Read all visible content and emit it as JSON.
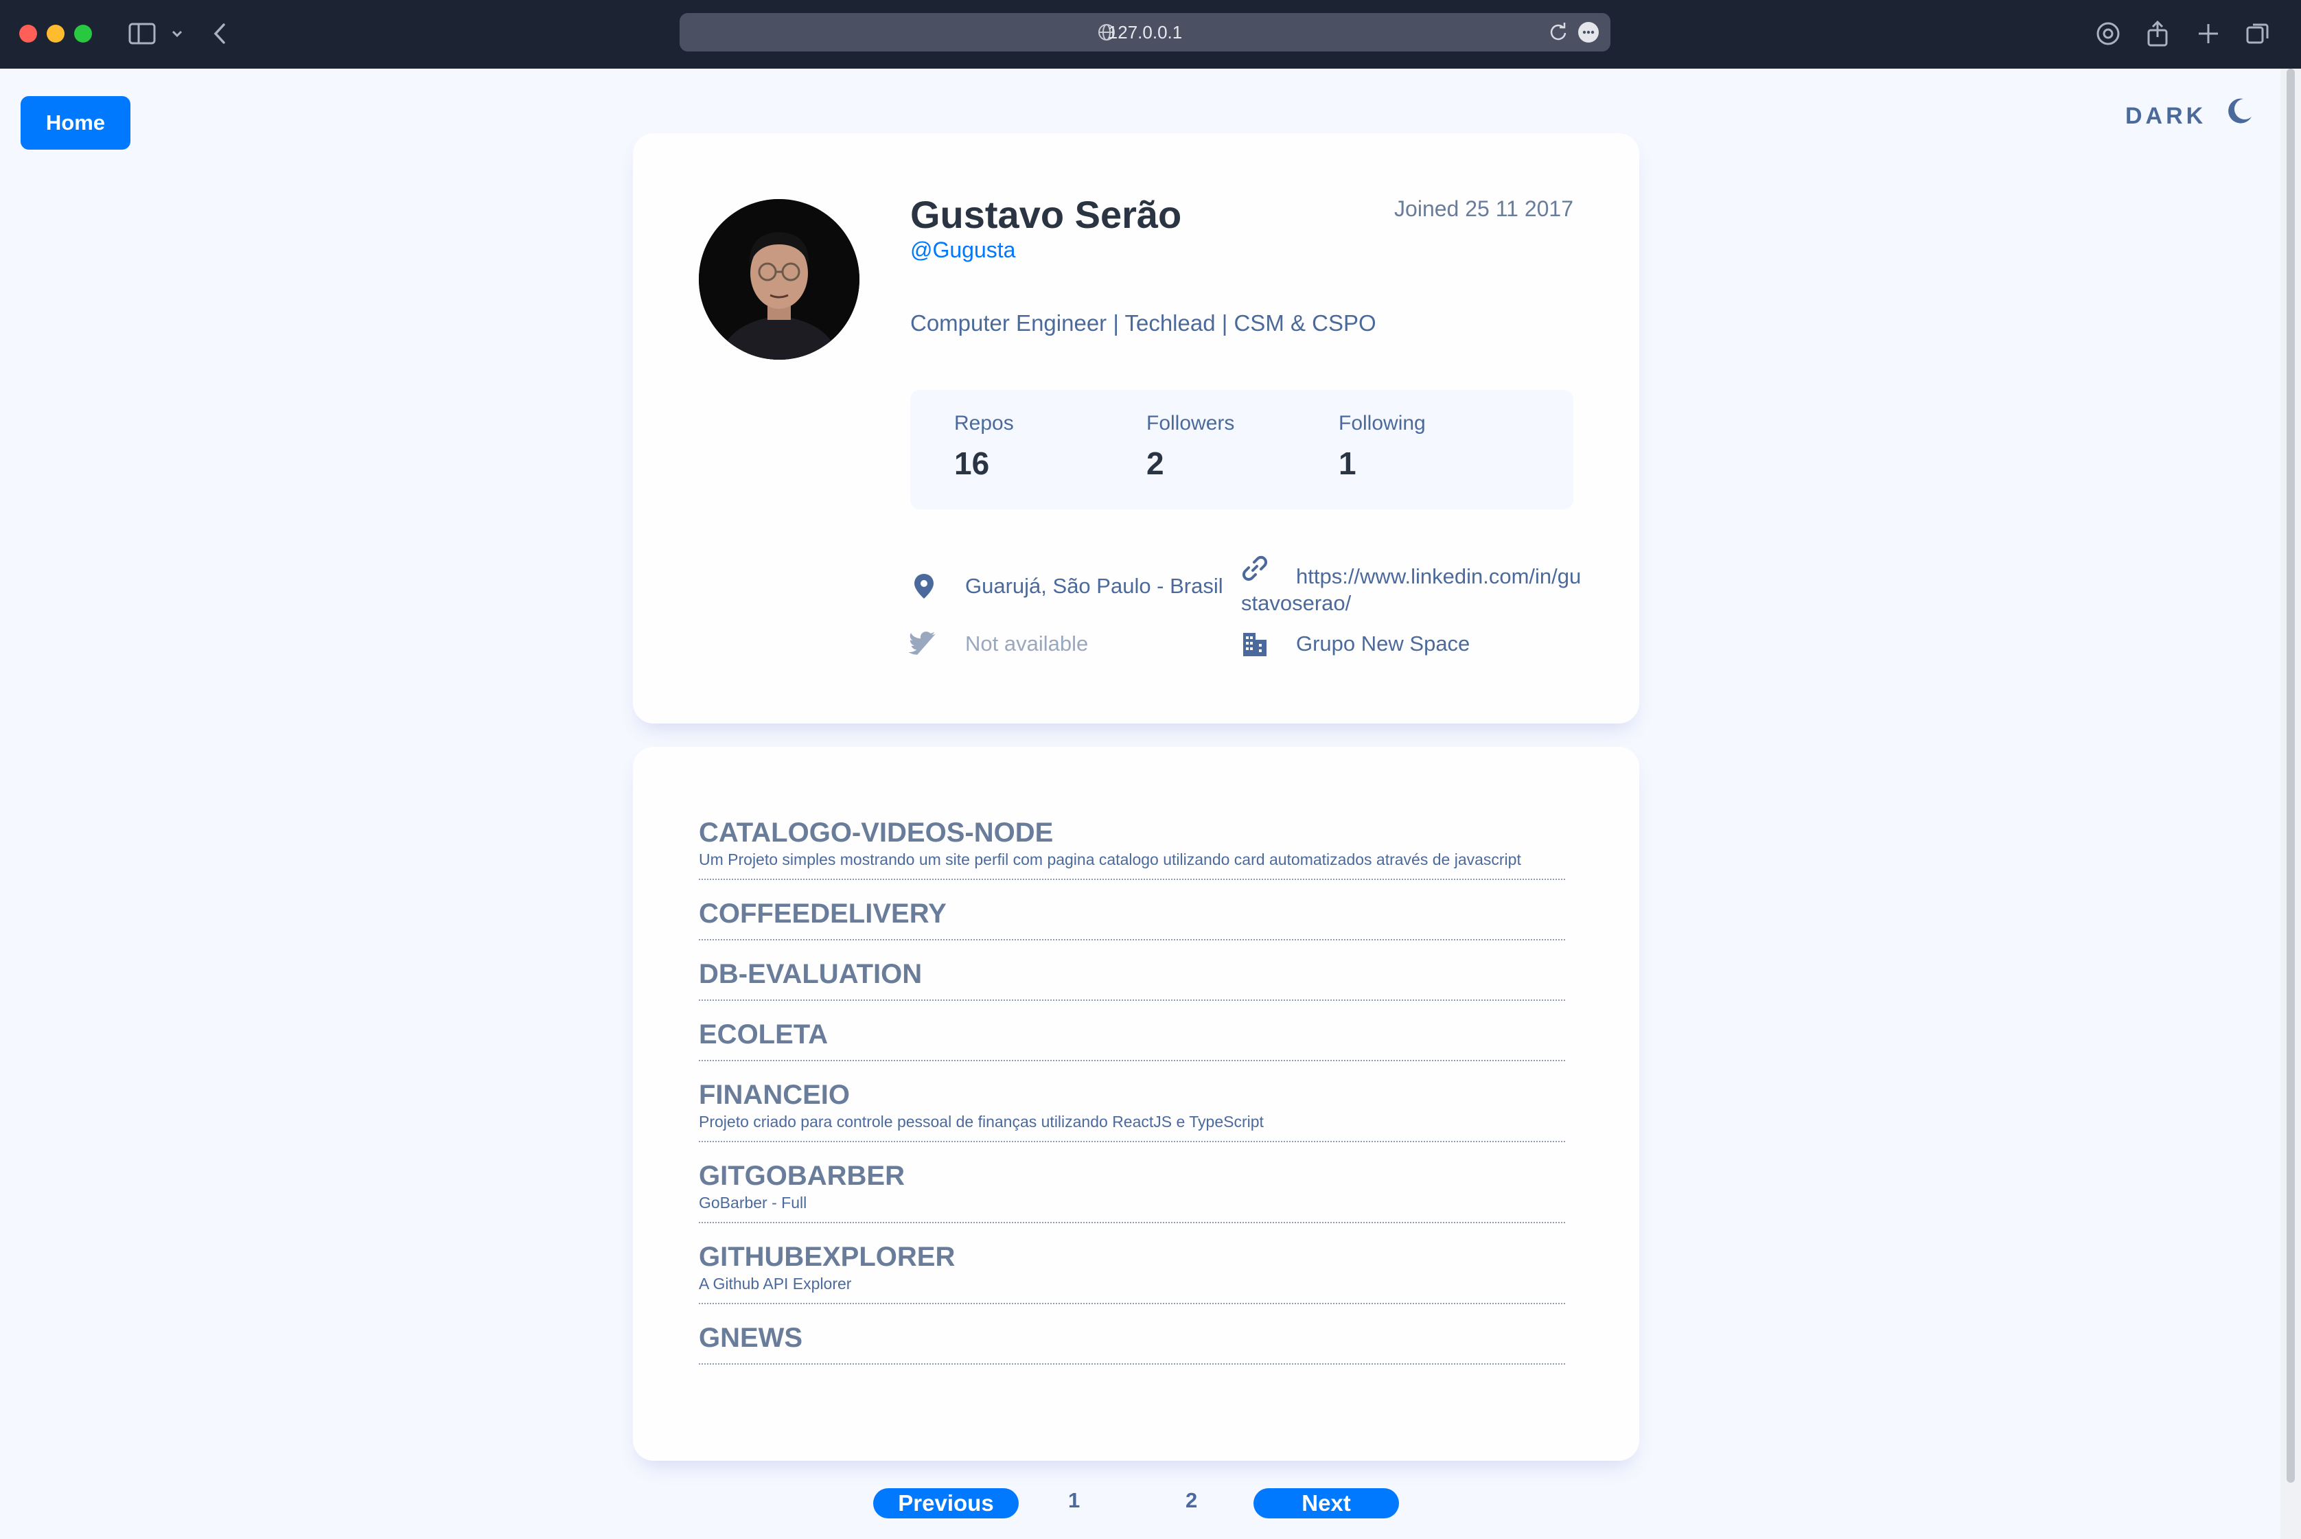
{
  "browser": {
    "url": "127.0.0.1"
  },
  "header": {
    "home_label": "Home",
    "theme_label": "DARK"
  },
  "profile": {
    "name": "Gustavo Serão",
    "handle": "@Gugusta",
    "joined": "Joined 25 11 2017",
    "bio": "Computer Engineer | Techlead | CSM & CSPO",
    "stats": {
      "repos_label": "Repos",
      "repos_value": "16",
      "followers_label": "Followers",
      "followers_value": "2",
      "following_label": "Following",
      "following_value": "1"
    },
    "location": "Guarujá, São Paulo - Brasil",
    "website_line1": "https://www.linkedin.com/in/gu",
    "website_line2": "stavoserao/",
    "twitter": "Not available",
    "company": "Grupo New Space"
  },
  "repos": [
    {
      "name": "CATALOGO-VIDEOS-NODE",
      "description": "Um Projeto simples mostrando um site perfil com pagina catalogo utilizando card automatizados através de javascript"
    },
    {
      "name": "COFFEEDELIVERY",
      "description": ""
    },
    {
      "name": "DB-EVALUATION",
      "description": ""
    },
    {
      "name": "ECOLETA",
      "description": ""
    },
    {
      "name": "FINANCEIO",
      "description": "Projeto criado para controle pessoal de finanças utilizando ReactJS e TypeScript"
    },
    {
      "name": "GITGOBARBER",
      "description": "GoBarber - Full"
    },
    {
      "name": "GITHUBEXPLORER",
      "description": "A Github API Explorer"
    },
    {
      "name": "GNEWS",
      "description": ""
    }
  ],
  "pagination": {
    "previous_label": "Previous",
    "pages": [
      "1",
      "2"
    ],
    "next_label": "Next"
  },
  "colors": {
    "accent": "#0079ff",
    "text_muted": "#4b6a9b",
    "heading": "#2b3442",
    "page_bg": "#f6f8ff"
  }
}
